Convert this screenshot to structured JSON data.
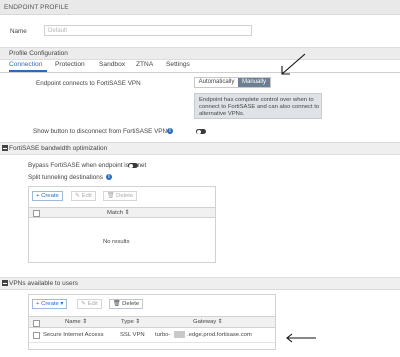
{
  "window": {
    "title": "ENDPOINT PROFILE"
  },
  "name_field": {
    "label": "Name",
    "placeholder": "Default"
  },
  "profile_config": {
    "heading": "Profile Configuration"
  },
  "tabs": [
    {
      "label": "Connection",
      "active": true
    },
    {
      "label": "Protection"
    },
    {
      "label": "Sandbox"
    },
    {
      "label": "ZTNA"
    },
    {
      "label": "Settings"
    }
  ],
  "connection": {
    "connect_label": "Endpoint connects to FortiSASE VPN",
    "options": [
      "Automatically",
      "Manually"
    ],
    "selected": "Manually",
    "tooltip": "Endpoint has complete control over when to connect to FortiSASE and can also connect to alternative VPNs.",
    "disconnect_label": "Show button to disconnect from FortiSASE VPN"
  },
  "bandwidth": {
    "heading": "FortiSASE bandwidth optimization",
    "bypass_label": "Bypass FortiSASE when endpoint is onnet",
    "split_label": "Split tunneling destinations",
    "create": "+ Create",
    "edit": "Edit",
    "delete": "Delete",
    "column_match": "Match",
    "no_results": "No results"
  },
  "vpns": {
    "heading": "VPNs available to users",
    "create": "+ Create",
    "edit": "Edit",
    "delete": "Delete",
    "columns": [
      "Name",
      "Type",
      "Gateway"
    ],
    "rows": [
      {
        "name": "Secure Internet Access",
        "type": "SSL VPN",
        "gateway_prefix": "turbo-",
        "gateway_suffix": ".edge.prod.fortisase.com"
      }
    ]
  },
  "colors": {
    "accent": "#2a6bbf",
    "selected_segment": "#6d7f95",
    "tooltip_bg": "#dfe3e8"
  }
}
